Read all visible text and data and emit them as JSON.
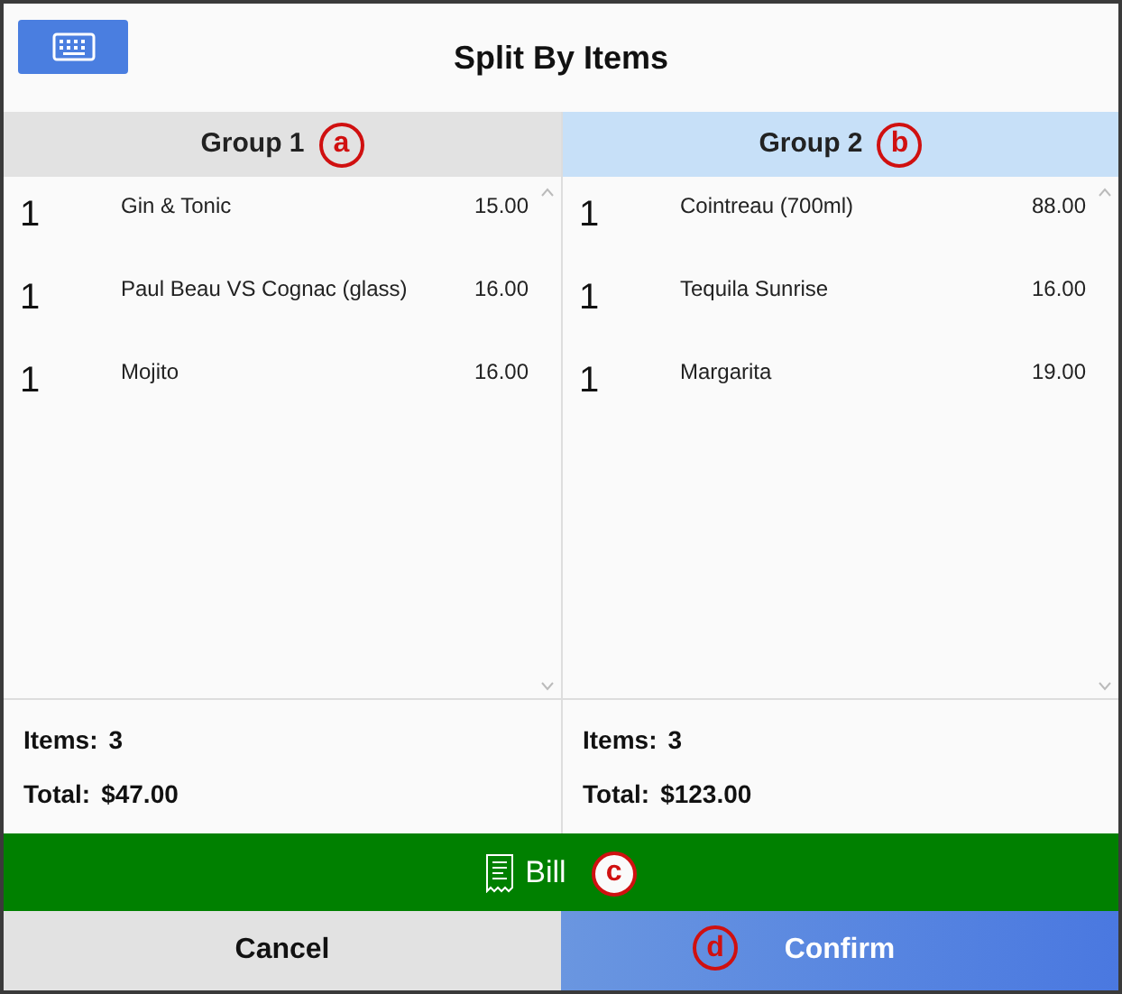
{
  "dialog": {
    "title": "Split By Items"
  },
  "groups": [
    {
      "label": "Group 1",
      "callout": "a",
      "selected": false,
      "items": [
        {
          "qty": "1",
          "name": "Gin & Tonic",
          "price": "15.00"
        },
        {
          "qty": "1",
          "name": "Paul Beau VS Cognac (glass)",
          "price": "16.00"
        },
        {
          "qty": "1",
          "name": "Mojito",
          "price": "16.00"
        }
      ],
      "items_label": "Items:",
      "items_count": "3",
      "total_label": "Total:",
      "total": "$47.00"
    },
    {
      "label": "Group 2",
      "callout": "b",
      "selected": true,
      "items": [
        {
          "qty": "1",
          "name": "Cointreau (700ml)",
          "price": "88.00"
        },
        {
          "qty": "1",
          "name": "Tequila Sunrise",
          "price": "16.00"
        },
        {
          "qty": "1",
          "name": "Margarita",
          "price": "19.00"
        }
      ],
      "items_label": "Items:",
      "items_count": "3",
      "total_label": "Total:",
      "total": "$123.00"
    }
  ],
  "bill_button": {
    "label": "Bill",
    "callout": "c"
  },
  "cancel_button": {
    "label": "Cancel"
  },
  "confirm_button": {
    "label": "Confirm",
    "callout": "d"
  }
}
